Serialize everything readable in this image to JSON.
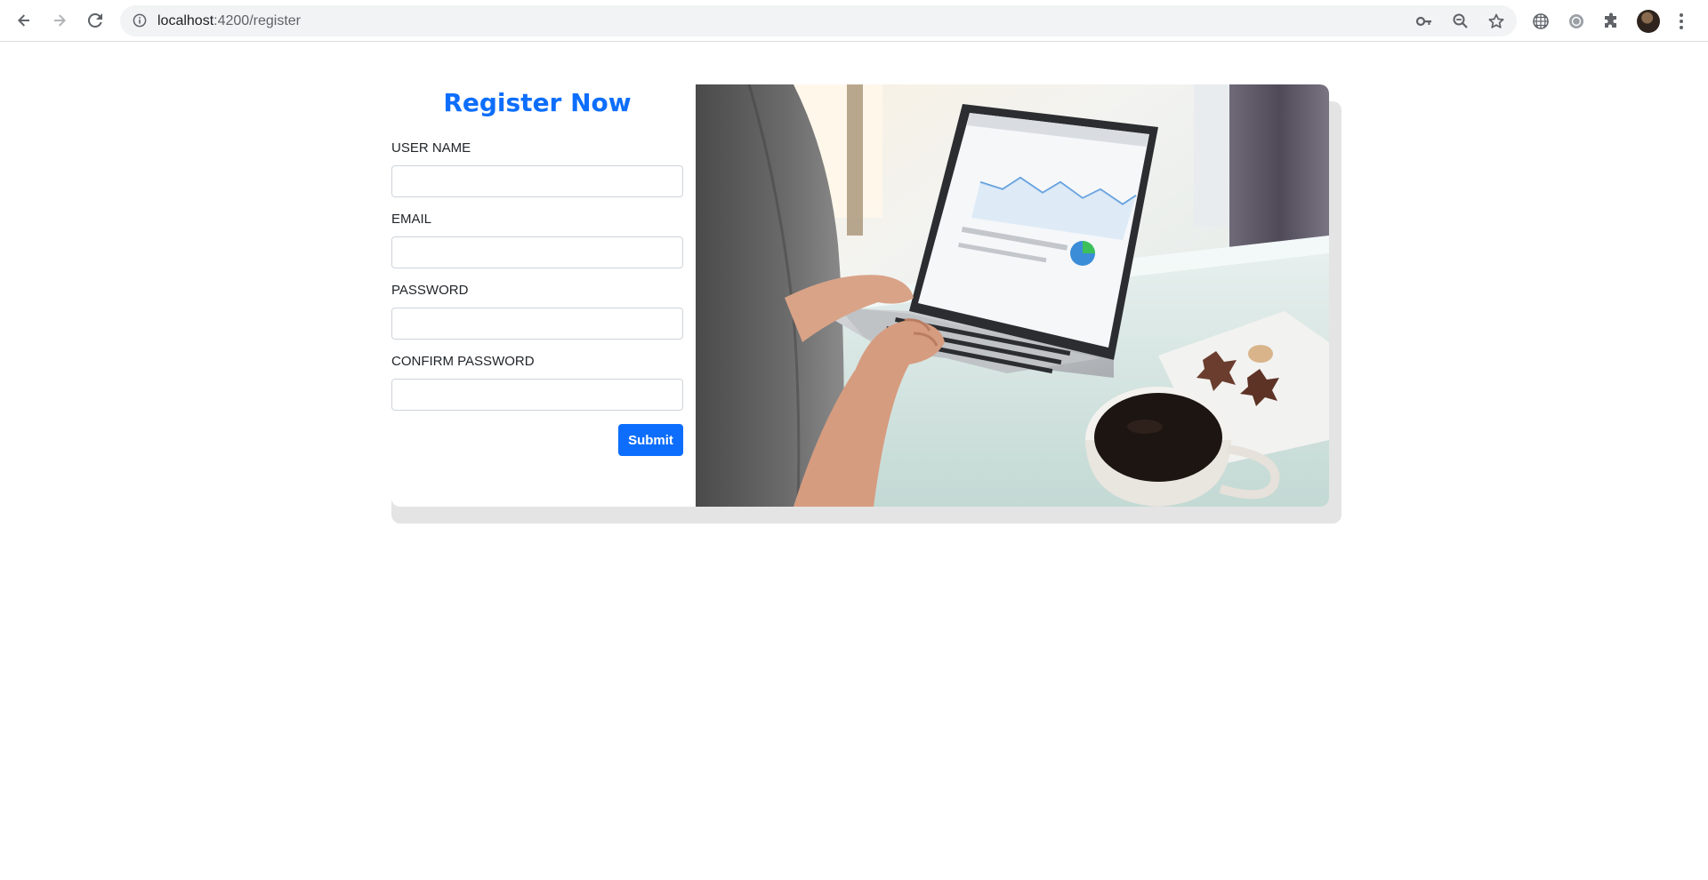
{
  "browser": {
    "url_host": "localhost",
    "url_path": ":4200/register"
  },
  "form": {
    "title": "Register Now",
    "fields": [
      {
        "label": "USER NAME",
        "value": "",
        "type": "text"
      },
      {
        "label": "EMAIL",
        "value": "",
        "type": "email"
      },
      {
        "label": "PASSWORD",
        "value": "",
        "type": "password"
      },
      {
        "label": "CONFIRM PASSWORD",
        "value": "",
        "type": "password"
      }
    ],
    "submit_label": "Submit"
  },
  "colors": {
    "accent": "#0d6efd",
    "card_shadow": "#e4e4e4"
  },
  "icons": {
    "back": "back-arrow-icon",
    "forward": "forward-arrow-icon",
    "reload": "reload-icon",
    "site_info": "info-icon",
    "password_key": "key-icon",
    "zoom": "zoom-out-icon",
    "bookmark": "star-icon",
    "extension_1": "grid-globe-icon",
    "extension_2": "circle-extension-icon",
    "extensions": "puzzle-icon",
    "menu": "kebab-menu-icon"
  }
}
